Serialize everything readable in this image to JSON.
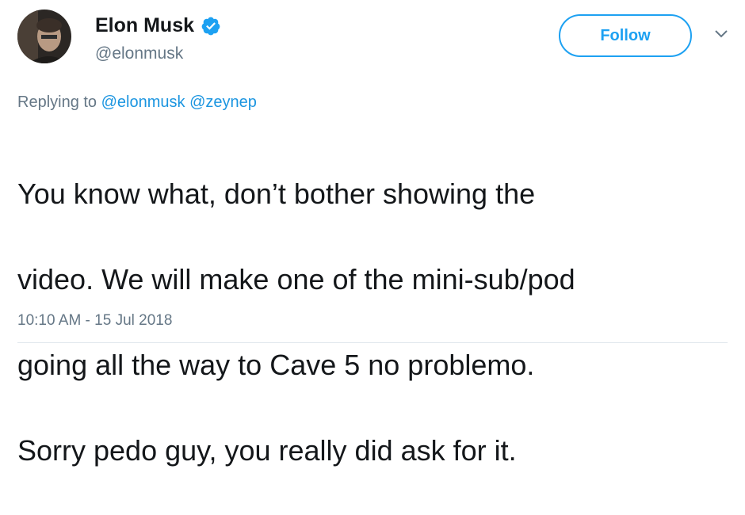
{
  "author": {
    "display_name": "Elon Musk",
    "handle": "@elonmusk",
    "verified": true
  },
  "actions": {
    "follow_label": "Follow",
    "menu_icon": "chevron-down-icon"
  },
  "reply": {
    "prefix": "Replying to",
    "mentions": [
      "@elonmusk",
      "@zeynep"
    ]
  },
  "tweet": {
    "lines": [
      "You know what, don’t bother showing the",
      "video. We will make one of the mini-sub/pod",
      "going all the way to Cave 5 no problemo.",
      "Sorry pedo guy, you really did ask for it."
    ],
    "timestamp": "10:10 AM - 15 Jul 2018"
  },
  "colors": {
    "accent": "#1da1f2",
    "mention": "#1b95e0",
    "muted": "#657786",
    "text": "#14171a"
  }
}
